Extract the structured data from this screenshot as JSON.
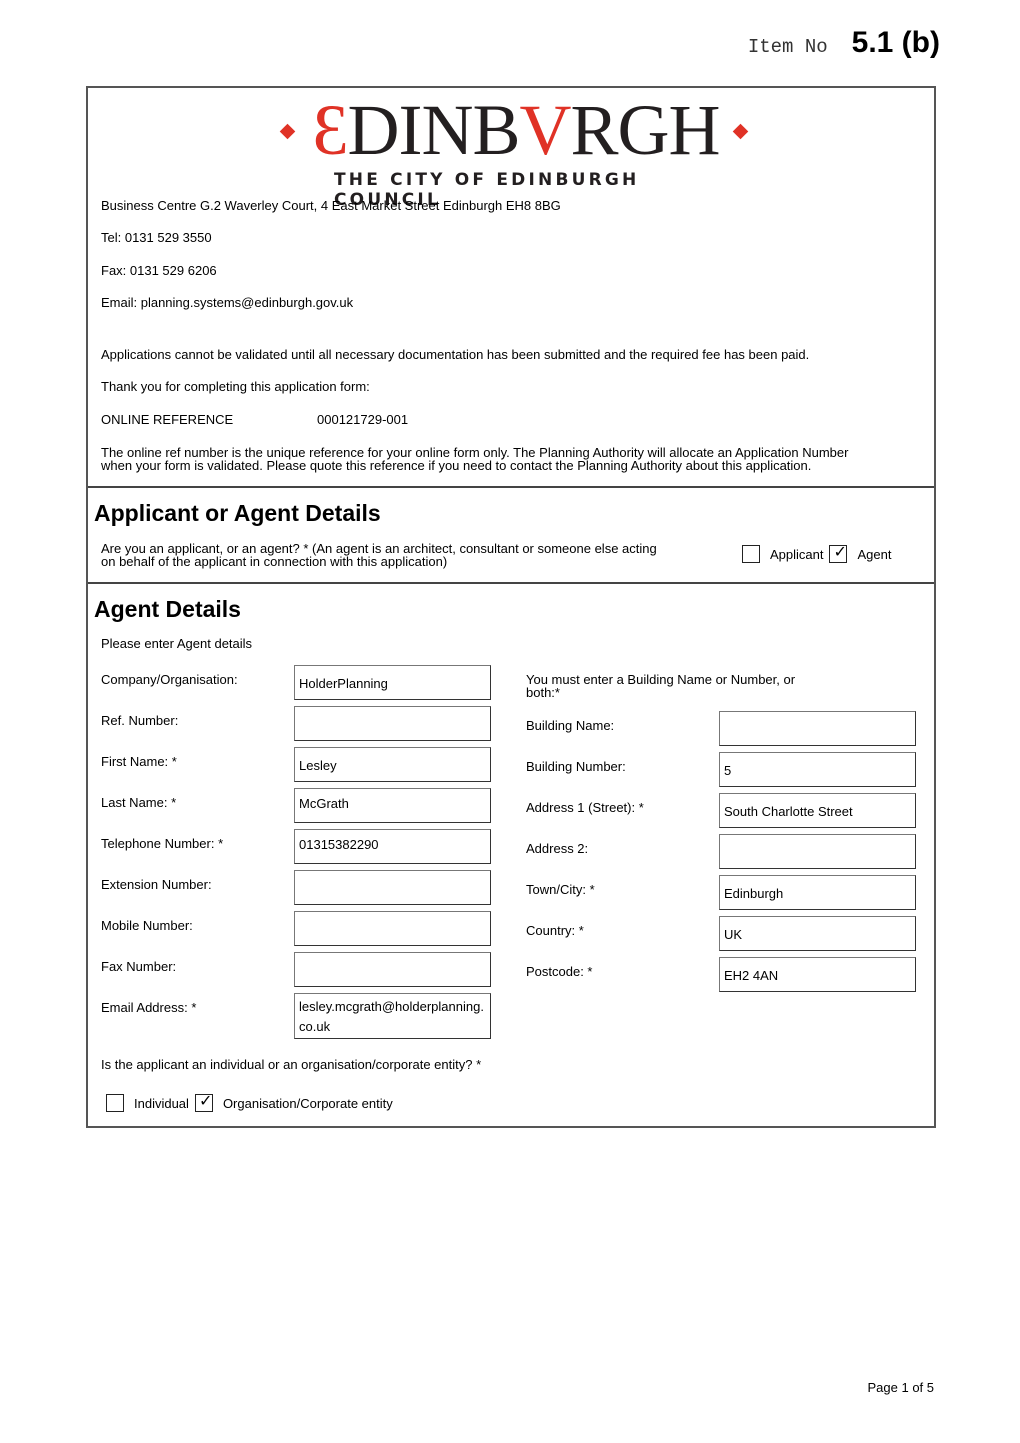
{
  "item_no": {
    "label": "Item No",
    "value": "5.1 (b)"
  },
  "logo": {
    "word_red_1": "Ɛ",
    "word_black_1": "DINB",
    "word_red_2": "V",
    "word_black_2": "RGH",
    "subtitle": "THE CITY OF EDINBURGH COUNCIL",
    "brand_red": "#e03226",
    "brand_dark": "#231f20"
  },
  "header": {
    "address": "Business Centre G.2 Waverley Court, 4 East Market Street Edinburgh EH8 8BG",
    "tel": "Tel: 0131 529 3550",
    "fax": "Fax: 0131 529 6206",
    "email": "Email: planning.systems@edinburgh.gov.uk",
    "validation_note": "Applications cannot be validated until all necessary documentation has been submitted and the required fee has been paid.",
    "thank_you": "Thank you for completing this application form:",
    "online_ref_label": "ONLINE REFERENCE",
    "online_ref_value": "000121729-001",
    "ref_note_line1": "The online ref number is the unique reference for your online form only. The Planning Authority will allocate an Application Number",
    "ref_note_line2": "when your form is validated. Please quote this reference if you need to contact the Planning Authority about this application."
  },
  "applicant_or_agent": {
    "title": "Applicant or Agent Details",
    "question_line1": "Are you an applicant, or an agent? * (An agent is an architect, consultant or someone else acting",
    "question_line2": "on behalf of the applicant in connection with this application)",
    "options": [
      {
        "label": "Applicant",
        "checked": false
      },
      {
        "label": "Agent",
        "checked": true
      }
    ],
    "tick": "✓"
  },
  "agent_details": {
    "title": "Agent Details",
    "intro": "Please enter Agent details",
    "left_fields": [
      {
        "label": "Company/Organisation:",
        "value": "HolderPlanning"
      },
      {
        "label": "Ref. Number:",
        "value": ""
      },
      {
        "label": "First Name: *",
        "value": "Lesley"
      },
      {
        "label": "Last Name: *",
        "value": "McGrath"
      },
      {
        "label": "Telephone Number: *",
        "value": "01315382290"
      },
      {
        "label": "Extension Number:",
        "value": ""
      },
      {
        "label": "Mobile Number:",
        "value": ""
      },
      {
        "label": "Fax Number:",
        "value": ""
      },
      {
        "label": "Email Address: *",
        "value": "lesley.mcgrath@holderplanning.co.uk"
      }
    ],
    "building_note_line1": "You must enter a Building Name or Number, or",
    "building_note_line2": "both:*",
    "right_fields": [
      {
        "label": "Building Name:",
        "value": ""
      },
      {
        "label": "Building Number:",
        "value": "5"
      },
      {
        "label": "Address 1 (Street): *",
        "value": "South Charlotte Street"
      },
      {
        "label": "Address 2:",
        "value": ""
      },
      {
        "label": "Town/City: *",
        "value": "Edinburgh"
      },
      {
        "label": "Country: *",
        "value": "UK"
      },
      {
        "label": "Postcode: *",
        "value": "EH2 4AN"
      }
    ],
    "entity_question": "Is the applicant an individual or an organisation/corporate entity? *",
    "entity_options": [
      {
        "label": "Individual",
        "checked": false
      },
      {
        "label": "Organisation/Corporate entity",
        "checked": true
      }
    ],
    "tick": "✓"
  },
  "footer": {
    "page": "Page 1 of 5"
  }
}
